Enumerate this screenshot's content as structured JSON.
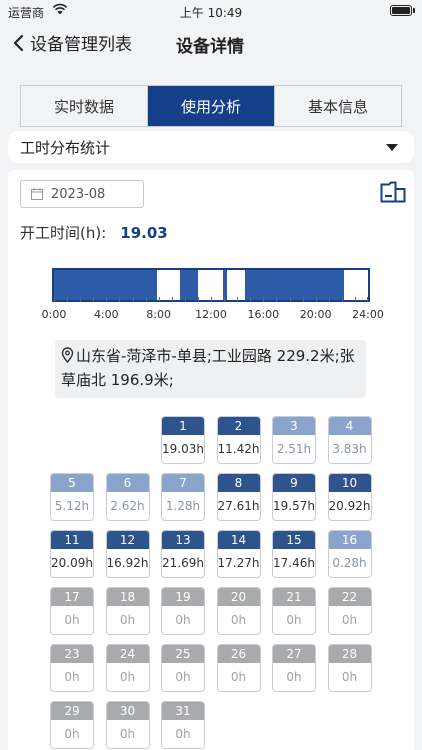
{
  "status": {
    "carrier": "运营商",
    "time": "上午 10:49"
  },
  "nav": {
    "back_label": "设备管理列表",
    "title": "设备详情"
  },
  "tabs": [
    {
      "label": "实时数据",
      "active": false
    },
    {
      "label": "使用分析",
      "active": true
    },
    {
      "label": "基本信息",
      "active": false
    }
  ],
  "dropdown": {
    "selected": "工时分布统计"
  },
  "date": {
    "value": "2023-08"
  },
  "worktime": {
    "label": "开工时间(h):",
    "value": "19.03"
  },
  "timeline": {
    "axis_labels": [
      "0:00",
      "4:00",
      "8:00",
      "12:00",
      "16:00",
      "20:00",
      "24:00"
    ],
    "active_hours": [
      [
        0,
        7.9
      ],
      [
        9.6,
        10.5
      ],
      [
        10.5,
        11.0
      ],
      [
        12.9,
        13.2
      ],
      [
        14.6,
        22.2
      ]
    ]
  },
  "location": {
    "text": "山东省-菏泽市-单县;工业园路 229.2米;张草庙北 196.9米;"
  },
  "days": [
    {
      "day": "1",
      "hours": "19.03h",
      "level": "high"
    },
    {
      "day": "2",
      "hours": "11.42h",
      "level": "high"
    },
    {
      "day": "3",
      "hours": "2.51h",
      "level": "low"
    },
    {
      "day": "4",
      "hours": "3.83h",
      "level": "low"
    },
    {
      "day": "5",
      "hours": "5.12h",
      "level": "low"
    },
    {
      "day": "6",
      "hours": "2.62h",
      "level": "low"
    },
    {
      "day": "7",
      "hours": "1.28h",
      "level": "low"
    },
    {
      "day": "8",
      "hours": "27.61h",
      "level": "high"
    },
    {
      "day": "9",
      "hours": "19.57h",
      "level": "high"
    },
    {
      "day": "10",
      "hours": "20.92h",
      "level": "high"
    },
    {
      "day": "11",
      "hours": "20.09h",
      "level": "high"
    },
    {
      "day": "12",
      "hours": "16.92h",
      "level": "high"
    },
    {
      "day": "13",
      "hours": "21.69h",
      "level": "high"
    },
    {
      "day": "14",
      "hours": "17.27h",
      "level": "high"
    },
    {
      "day": "15",
      "hours": "17.46h",
      "level": "high"
    },
    {
      "day": "16",
      "hours": "0.28h",
      "level": "low"
    },
    {
      "day": "17",
      "hours": "0h",
      "level": "none"
    },
    {
      "day": "18",
      "hours": "0h",
      "level": "none"
    },
    {
      "day": "19",
      "hours": "0h",
      "level": "none"
    },
    {
      "day": "20",
      "hours": "0h",
      "level": "none"
    },
    {
      "day": "21",
      "hours": "0h",
      "level": "none"
    },
    {
      "day": "22",
      "hours": "0h",
      "level": "none"
    },
    {
      "day": "23",
      "hours": "0h",
      "level": "none"
    },
    {
      "day": "24",
      "hours": "0h",
      "level": "none"
    },
    {
      "day": "25",
      "hours": "0h",
      "level": "none"
    },
    {
      "day": "26",
      "hours": "0h",
      "level": "none"
    },
    {
      "day": "27",
      "hours": "0h",
      "level": "none"
    },
    {
      "day": "28",
      "hours": "0h",
      "level": "none"
    },
    {
      "day": "29",
      "hours": "0h",
      "level": "none"
    },
    {
      "day": "30",
      "hours": "0h",
      "level": "none"
    },
    {
      "day": "31",
      "hours": "0h",
      "level": "none"
    }
  ],
  "colors": {
    "accent": "#163f8a",
    "bar": "#2d5ba8",
    "high": "#2e548e",
    "low": "#8aa4cb",
    "none": "#a9aaac"
  }
}
